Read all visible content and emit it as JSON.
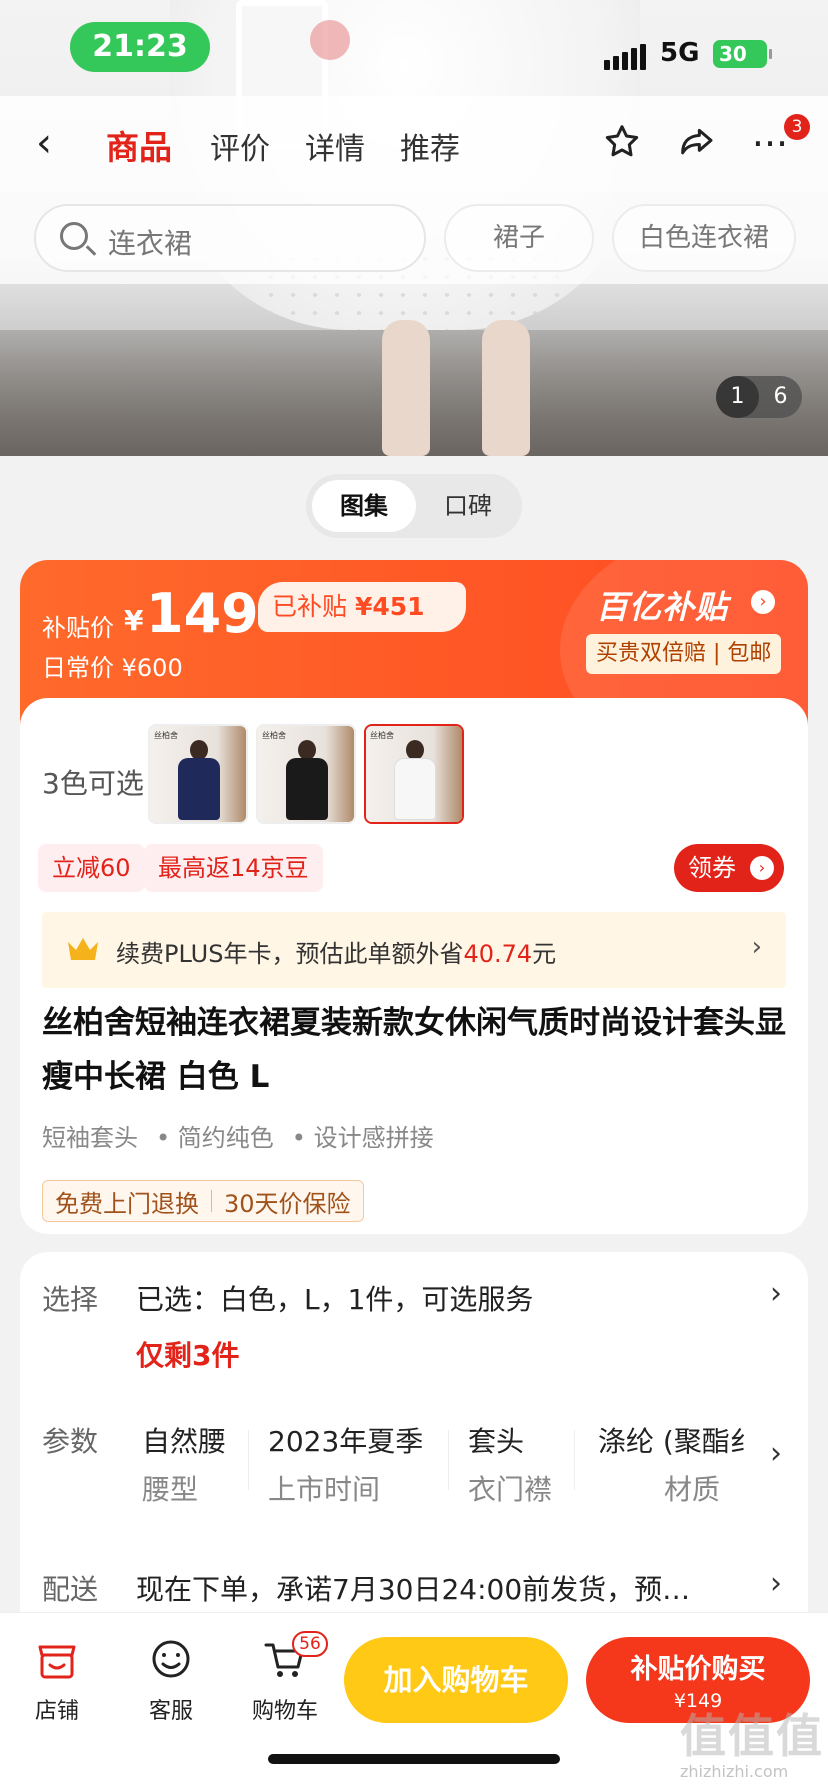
{
  "status": {
    "time": "21:23",
    "network": "5G",
    "battery": "30"
  },
  "nav": {
    "tabs": [
      "商品",
      "评价",
      "详情",
      "推荐"
    ],
    "active_tab": "商品",
    "more_badge": "3"
  },
  "search": {
    "value": "连衣裙",
    "chips": [
      "裙子",
      "白色连衣裙"
    ]
  },
  "gallery": {
    "current": "1",
    "total": "6",
    "toggle": [
      "图集",
      "口碑"
    ]
  },
  "price": {
    "subsidy_label": "补贴价",
    "currency": "¥",
    "subsidy_price": "149",
    "subsidized_amount_label": "已补贴",
    "subsidized_amount": "¥451",
    "daily_label": "日常价",
    "daily_price": "¥600",
    "brand": "百亿补贴",
    "guarantee": "买贵双倍赔 | 包邮"
  },
  "product": {
    "colors_label": "3色可选",
    "thumbnails": [
      {
        "name": "navy",
        "color": "#1f2a5a"
      },
      {
        "name": "black",
        "color": "#1a1a1a"
      },
      {
        "name": "white",
        "color": "#f2f2f2"
      }
    ],
    "tags": [
      "立减60",
      "最高返14京豆"
    ],
    "coupon_btn": "领券",
    "plus_text_prefix": "续费PLUS年卡，预估此单额外省",
    "plus_amount": "40.74",
    "plus_text_suffix": "元",
    "title": "丝柏舍短袖连衣裙夏装新款女休闲气质时尚设计套头显瘦中长裙 白色 L",
    "attributes": [
      "短袖套头",
      "• 简约纯色",
      "• 设计感拼接"
    ],
    "service_badges": [
      "免费上门退换",
      "30天价保险"
    ]
  },
  "info": {
    "select_label": "选择",
    "select_value": "已选：白色，L，1件，可选服务",
    "stock_warning": "仅剩3件",
    "params_label": "参数",
    "params": [
      {
        "value": "自然腰",
        "key": "腰型"
      },
      {
        "value": "2023年夏季",
        "key": "上市时间"
      },
      {
        "value": "套头",
        "key": "衣门襟"
      },
      {
        "value": "涤纶 (聚酯纟",
        "key": "材质"
      }
    ],
    "delivery_label": "配送",
    "delivery_value": "现在下单，承诺7月30日24:00前发货，预…"
  },
  "bottom": {
    "store": "店铺",
    "service": "客服",
    "cart": "购物车",
    "cart_count": "56",
    "add_to_cart": "加入购物车",
    "buy_label": "补贴价购买",
    "buy_price": "¥149"
  },
  "watermark": {
    "logo": "值值值",
    "site": "zhizhizhi.com"
  }
}
